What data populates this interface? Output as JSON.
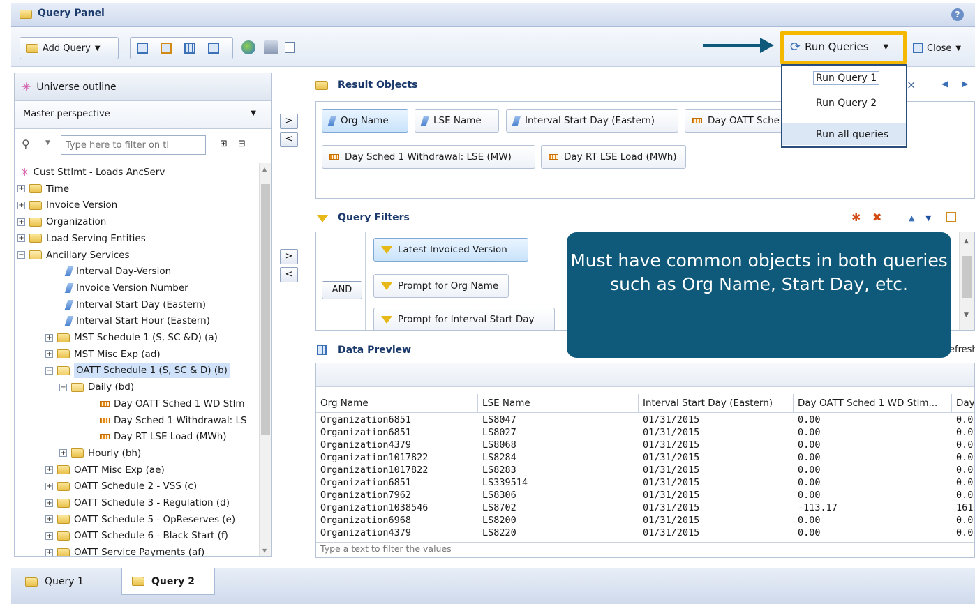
{
  "window": {
    "title": "Query Panel"
  },
  "toolbar": {
    "add_query": "Add Query",
    "run_queries": "Run Queries",
    "close": "Close"
  },
  "run_menu": {
    "items": [
      "Run Query 1",
      "Run Query 2",
      "Run all queries"
    ]
  },
  "universe": {
    "header": "Universe outline",
    "perspective": "Master perspective",
    "filter_placeholder": "Type here to filter on tl",
    "tree": [
      {
        "label": "Cust Sttlmt - Loads AncServ",
        "type": "root",
        "depth": 0
      },
      {
        "label": "Time",
        "type": "folder",
        "depth": 0,
        "toggle": "+"
      },
      {
        "label": "Invoice Version",
        "type": "folder",
        "depth": 0,
        "toggle": "+"
      },
      {
        "label": "Organization",
        "type": "folder",
        "depth": 0,
        "toggle": "+"
      },
      {
        "label": "Load Serving Entities",
        "type": "folder",
        "depth": 0,
        "toggle": "+"
      },
      {
        "label": "Ancillary Services",
        "type": "folder-open",
        "depth": 0,
        "toggle": "−"
      },
      {
        "label": "Interval Day-Version",
        "type": "dim",
        "depth": 1
      },
      {
        "label": "Invoice Version Number",
        "type": "dim",
        "depth": 1
      },
      {
        "label": "Interval Start Day (Eastern)",
        "type": "dim",
        "depth": 1
      },
      {
        "label": "Interval Start Hour (Eastern)",
        "type": "dim",
        "depth": 1
      },
      {
        "label": "MST Schedule 1 (S, SC &D) (a)",
        "type": "folder",
        "depth": 1,
        "toggle": "+"
      },
      {
        "label": "MST Misc Exp (ad)",
        "type": "folder",
        "depth": 1,
        "toggle": "+"
      },
      {
        "label": "OATT Schedule 1 (S, SC & D) (b)",
        "type": "folder-open",
        "depth": 1,
        "toggle": "−",
        "selected": true
      },
      {
        "label": "Daily (bd)",
        "type": "folder-open",
        "depth": 2,
        "toggle": "−"
      },
      {
        "label": "Day OATT Sched 1 WD Stlm",
        "type": "meas",
        "depth": 3
      },
      {
        "label": "Day Sched 1 Withdrawal: LS",
        "type": "meas",
        "depth": 3
      },
      {
        "label": "Day RT LSE Load (MWh)",
        "type": "meas",
        "depth": 3
      },
      {
        "label": "Hourly (bh)",
        "type": "folder",
        "depth": 2,
        "toggle": "+"
      },
      {
        "label": "OATT Misc Exp (ae)",
        "type": "folder",
        "depth": 1,
        "toggle": "+"
      },
      {
        "label": "OATT Schedule 2 - VSS (c)",
        "type": "folder",
        "depth": 1,
        "toggle": "+"
      },
      {
        "label": "OATT Schedule 3 - Regulation (d)",
        "type": "folder",
        "depth": 1,
        "toggle": "+"
      },
      {
        "label": "OATT Schedule 5 - OpReserves (e)",
        "type": "folder",
        "depth": 1,
        "toggle": "+"
      },
      {
        "label": "OATT Schedule 6 - Black Start (f)",
        "type": "folder",
        "depth": 1,
        "toggle": "+"
      },
      {
        "label": "OATT Service Payments (af)",
        "type": "folder",
        "depth": 1,
        "toggle": "+"
      }
    ]
  },
  "result_objects": {
    "header": "Result Objects",
    "chips": [
      {
        "label": "Org Name",
        "type": "dim",
        "selected": true
      },
      {
        "label": "LSE Name",
        "type": "dim"
      },
      {
        "label": "Interval Start Day (Eastern)",
        "type": "dim"
      },
      {
        "label": "Day OATT Sche",
        "type": "meas"
      },
      {
        "label": "Day Sched 1 Withdrawal: LSE (MW)",
        "type": "meas"
      },
      {
        "label": "Day RT LSE Load (MWh)",
        "type": "meas"
      }
    ]
  },
  "query_filters": {
    "header": "Query Filters",
    "operator": "AND",
    "items": [
      "Latest Invoiced Version",
      "Prompt for Org Name",
      "Prompt for Interval Start Day"
    ]
  },
  "data_preview": {
    "header": "Data Preview",
    "refresh": "efresh",
    "columns": [
      "Org Name",
      "LSE Name",
      "Interval Start Day (Eastern)",
      "Day OATT Sched 1 WD Stlm...",
      "Day"
    ],
    "rows": [
      [
        "Organization6851",
        "LS8047",
        "01/31/2015",
        "0.00",
        "0.0"
      ],
      [
        "Organization6851",
        "LS8027",
        "01/31/2015",
        "0.00",
        "0.0"
      ],
      [
        "Organization4379",
        "LS8068",
        "01/31/2015",
        "0.00",
        "0.0"
      ],
      [
        "Organization1017822",
        "LS8284",
        "01/31/2015",
        "0.00",
        "0.0"
      ],
      [
        "Organization1017822",
        "LS8283",
        "01/31/2015",
        "0.00",
        "0.0"
      ],
      [
        "Organization6851",
        "LS339514",
        "01/31/2015",
        "0.00",
        "0.0"
      ],
      [
        "Organization7962",
        "LS8306",
        "01/31/2015",
        "0.00",
        "0.0"
      ],
      [
        "Organization1038546",
        "LS8702",
        "01/31/2015",
        "-113.17",
        "161"
      ],
      [
        "Organization6968",
        "LS8200",
        "01/31/2015",
        "0.00",
        "0.0"
      ],
      [
        "Organization4379",
        "LS8220",
        "01/31/2015",
        "0.00",
        "0.0"
      ]
    ],
    "filter_hint": "Type a text to filter the values"
  },
  "callout": {
    "text": "Must have common objects in both queries such as Org Name, Start Day, etc."
  },
  "tabs": [
    "Query 1",
    "Query 2"
  ],
  "colors": {
    "callout": "#0f5a7a",
    "highlight": "#f5b800",
    "arrow": "#0f5a7a"
  }
}
